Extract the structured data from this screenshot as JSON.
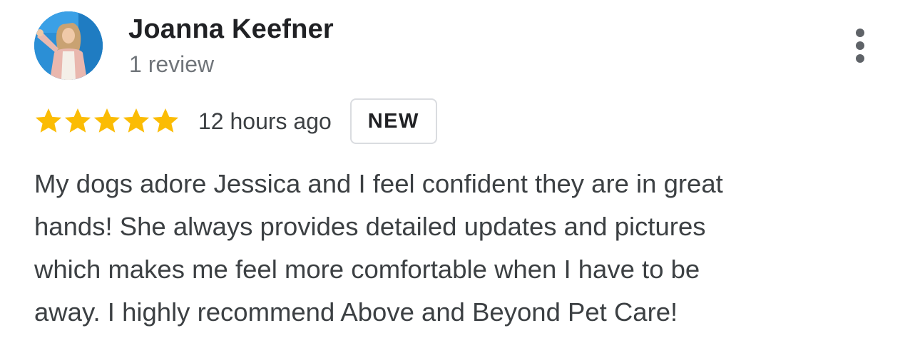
{
  "reviewer": {
    "name": "Joanna Keefner",
    "review_count": "1 review",
    "avatar": "profile-photo"
  },
  "rating": {
    "stars": 5,
    "max_stars": 5,
    "star_color": "#fbbc04",
    "timestamp": "12 hours ago",
    "badge": "NEW"
  },
  "menu": {
    "icon": "more-vertical-icon"
  },
  "review": {
    "lines": [
      "My dogs adore Jessica and I feel confident they are in great",
      "hands! She always provides detailed updates and pictures",
      "which makes me feel more comfortable when I have to be",
      "away. I highly recommend Above and Beyond Pet Care!"
    ]
  },
  "colors": {
    "name": "#202124",
    "secondary": "#70757a",
    "body": "#3c4043",
    "badge_border": "#dadce0",
    "star": "#fbbc04"
  }
}
